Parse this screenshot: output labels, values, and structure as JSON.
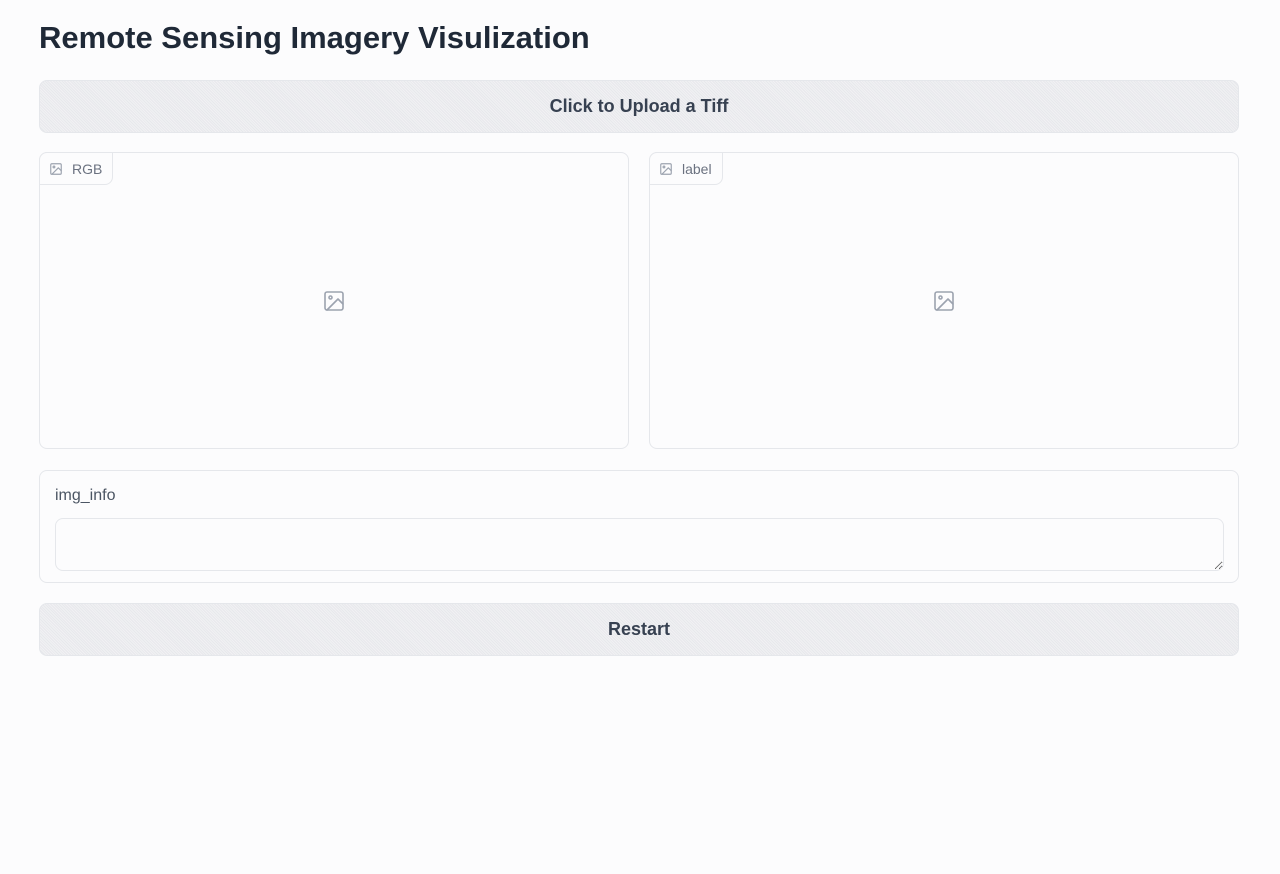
{
  "header": {
    "title": "Remote Sensing Imagery Visulization"
  },
  "upload_button": {
    "label": "Click to Upload a Tiff"
  },
  "image_panels": [
    {
      "label": "RGB",
      "icon": "image-icon"
    },
    {
      "label": "label",
      "icon": "image-icon"
    }
  ],
  "img_info": {
    "label": "img_info",
    "value": ""
  },
  "restart_button": {
    "label": "Restart"
  }
}
